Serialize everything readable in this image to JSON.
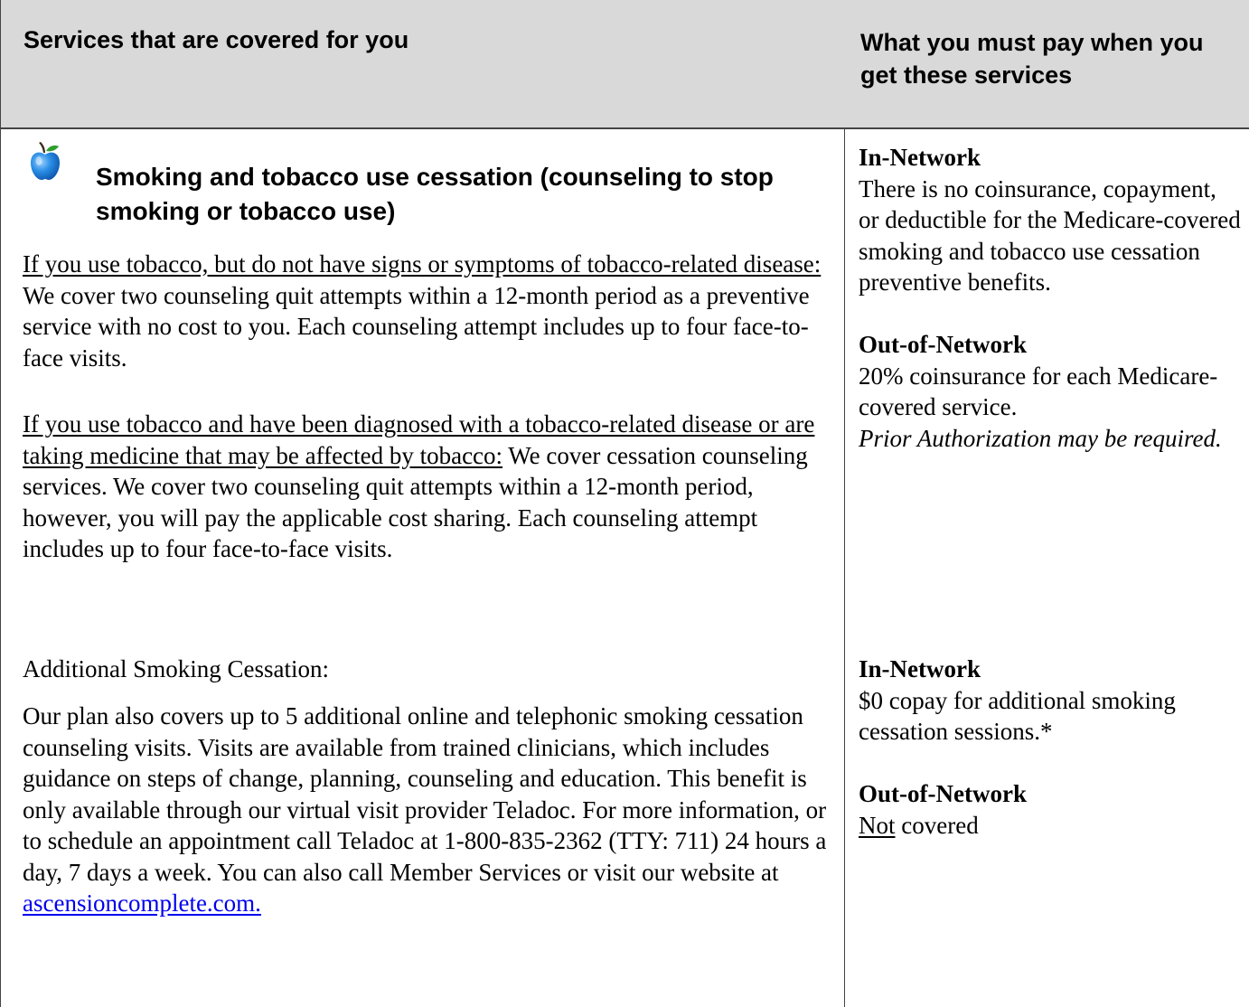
{
  "header": {
    "left": "Services that are covered for you",
    "right": "What you must pay when you get these services"
  },
  "service": {
    "title": "Smoking and tobacco use cessation (counseling to stop smoking or tobacco use)",
    "p1_underlined": "If you use tobacco, but do not have signs or symptoms of tobacco-related disease:",
    "p1_rest": " We cover two counseling quit attempts within a 12-month period as a preventive service with no cost to you. Each counseling attempt includes up to four face-to-face visits.",
    "p2_underlined": "If you use tobacco and have been diagnosed with a tobacco-related disease or are taking medicine that may be affected by tobacco:",
    "p2_rest": " We cover cessation counseling services. We cover two counseling quit attempts within a 12-month period, however, you will pay the applicable cost sharing. Each counseling attempt includes up to four face-to-face visits.",
    "p3": "Additional Smoking Cessation:",
    "p4": "Our plan also covers up to 5 additional online and telephonic smoking cessation counseling visits. Visits are available from trained clinicians, which includes guidance on steps of change, planning, counseling and education. This benefit is only available through our virtual visit provider Teladoc. For more information, or to schedule an appointment call Teladoc at 1-800-835-2362 (TTY: 711) 24 hours a day, 7 days a week. You can also call Member Services or visit our website at ",
    "p4_link": "ascensioncomplete.com. "
  },
  "costs": {
    "block1_in_head": "In-Network",
    "block1_in_text": "There is no coinsurance, copayment, or deductible for the Medicare-covered smoking and tobacco use cessation preventive benefits.",
    "block1_out_head": "Out-of-Network",
    "block1_out_text": "20% coinsurance for each Medicare-covered service.",
    "block1_out_note": "Prior Authorization may be required.",
    "block2_in_head": "In-Network",
    "block2_in_text": "$0 copay for additional smoking cessation sessions.*",
    "block2_out_head": "Out-of-Network",
    "block2_out_underlined": "Not",
    "block2_out_rest": " covered"
  },
  "icons": {
    "apple": "apple-icon"
  }
}
